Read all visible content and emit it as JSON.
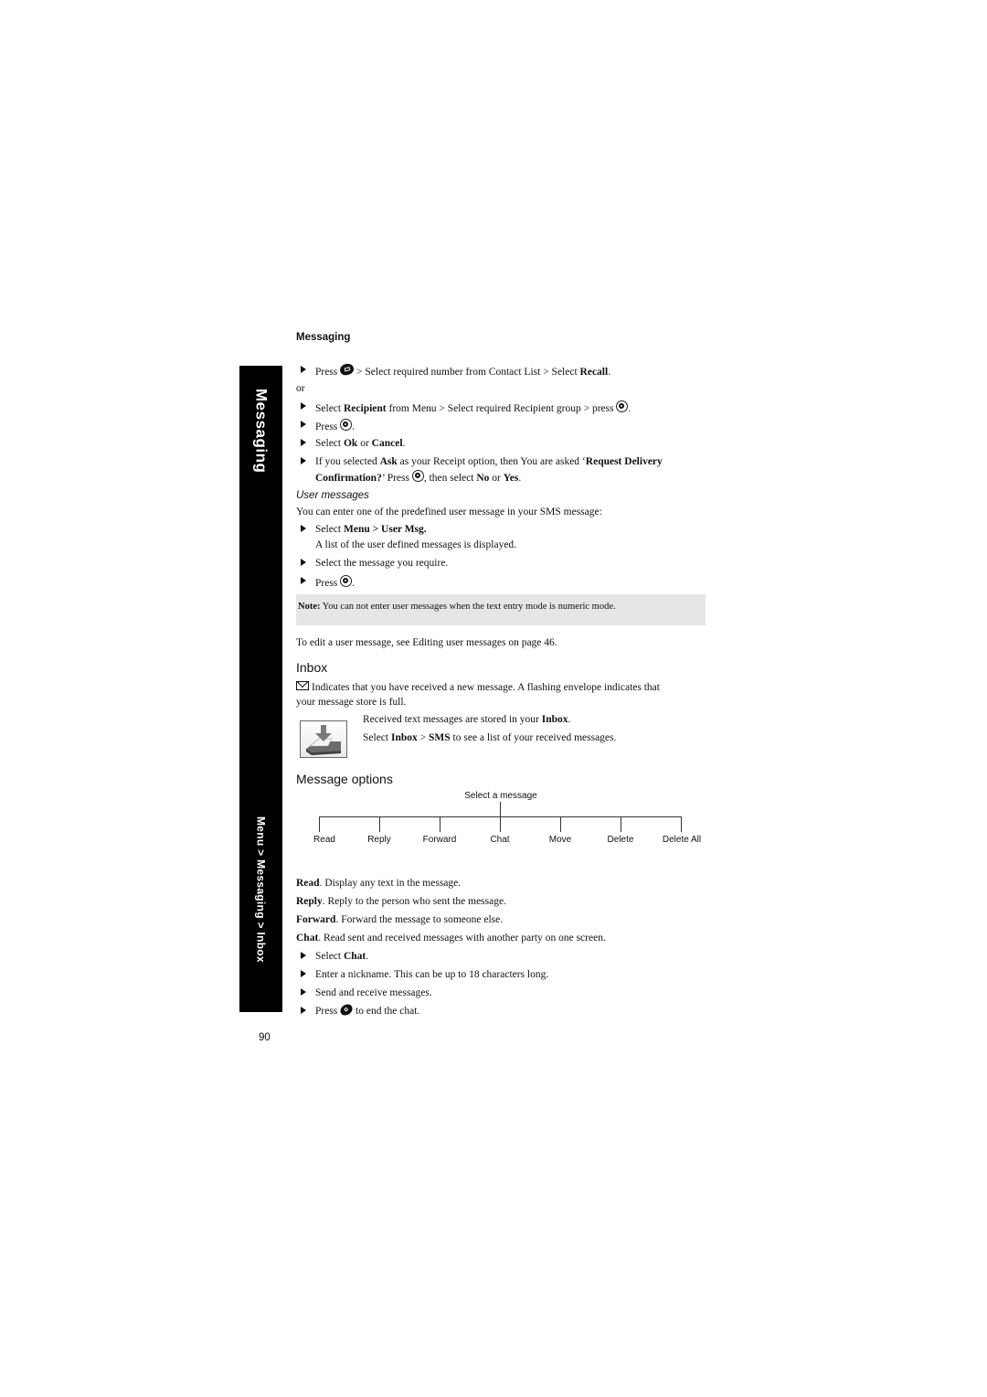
{
  "sidebar": {
    "title": "Messaging",
    "path": "Menu > Messaging > Inbox"
  },
  "running_head": "Messaging",
  "recall_steps": {
    "step1": {
      "pre": "Press",
      "icon": "send-key-icon",
      "post": "> Select required number from Contact List > Select",
      "bold": "Recall",
      "end": "."
    },
    "or": "or",
    "step2": {
      "pre": "Select",
      "bold1": "Recipient",
      "mid": "from Menu > Select required Recipient group > press",
      "icon": "ok-key-icon",
      "end": "."
    },
    "step3": {
      "pre": "Press",
      "icon": "ok-key-icon",
      "end": "."
    },
    "step4": {
      "pre": "Select",
      "bold1": "Ok",
      "mid": "or",
      "bold2": "Cancel",
      "end": "."
    },
    "step5": {
      "line1_pre": "If you selected",
      "line1_bold1": "Ask",
      "line1_mid": "as your Receipt option, then You are asked ‘",
      "line1_bold2": "Request Delivery",
      "line2_bold": "Confirmation?",
      "line2_mid": "’ Press",
      "line2_icon": "ok-key-icon",
      "line2_post": ", then select",
      "line2_bold2": "No",
      "line2_or": "or",
      "line2_bold3": "Yes",
      "line2_end": "."
    }
  },
  "user_messages": {
    "heading": "User messages",
    "intro": "You can enter one of the predefined user message in your SMS message:",
    "step1": {
      "pre": "Select",
      "bold": "Menu > User Msg."
    },
    "step1_detail": "A list of the user defined messages is displayed.",
    "step2": "Select the message you require.",
    "step3": {
      "pre": "Press",
      "icon": "ok-key-icon",
      "end": "."
    },
    "note_label": "Note:",
    "note_text": "You can not enter user messages when the text entry mode is numeric mode.",
    "edit_ref": "To edit a user message, see Editing user messages on page 46."
  },
  "inbox": {
    "heading": "Inbox",
    "envelope_text_line1": "Indicates that you have received a new message. A flashing envelope indicates that",
    "envelope_text_line2": "your message store is full.",
    "stored_pre": "Received text messages are stored in your",
    "stored_bold": "Inbox",
    "stored_end": ".",
    "select_pre": "Select",
    "select_bold1": "Inbox",
    "select_sep": ">",
    "select_bold2": "SMS",
    "select_post": "to see a list of your received messages."
  },
  "message_options": {
    "heading": "Message options",
    "tree_root": "Select a message",
    "tree_leaves": [
      "Read",
      "Reply",
      "Forward",
      "Chat",
      "Move",
      "Delete",
      "Delete All"
    ],
    "descriptions": [
      {
        "term": "Read",
        "text": ". Display any text in the message."
      },
      {
        "term": "Reply",
        "text": ". Reply to the person who sent the message."
      },
      {
        "term": "Forward",
        "text": ". Forward the message to someone else."
      },
      {
        "term": "Chat",
        "text": ". Read sent and received messages with another party on one screen."
      }
    ],
    "chat_steps": {
      "step1_pre": "Select",
      "step1_bold": "Chat",
      "step1_end": ".",
      "step2": "Enter a nickname. This can be up to 18 characters long.",
      "step3": "Send and receive messages.",
      "step4_pre": "Press",
      "step4_icon": "end-key-icon",
      "step4_post": "to end the chat."
    }
  },
  "page_number": "90"
}
